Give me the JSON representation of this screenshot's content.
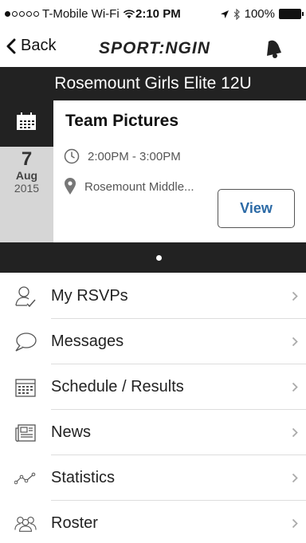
{
  "status_bar": {
    "carrier": "T-Mobile Wi-Fi",
    "time": "2:10 PM",
    "battery": "100%"
  },
  "nav": {
    "back_label": "Back",
    "logo_text": "SPORT:NGIN"
  },
  "team": {
    "name": "Rosemount Girls Elite 12U"
  },
  "event": {
    "day": "7",
    "month": "Aug",
    "year": "2015",
    "title": "Team Pictures",
    "time": "2:00PM - 3:00PM",
    "location": "Rosemount Middle...",
    "view_label": "View"
  },
  "menu": {
    "items": [
      {
        "label": "My RSVPs",
        "icon": "rsvp-person-icon"
      },
      {
        "label": "Messages",
        "icon": "speech-bubble-icon"
      },
      {
        "label": "Schedule / Results",
        "icon": "calendar-grid-icon"
      },
      {
        "label": "News",
        "icon": "newspaper-icon"
      },
      {
        "label": "Statistics",
        "icon": "line-graph-icon"
      },
      {
        "label": "Roster",
        "icon": "group-people-icon"
      }
    ]
  },
  "colors": {
    "dark_bar": "#222222",
    "date_column": "#d6d6d6",
    "link_blue": "#2b6aa6"
  }
}
